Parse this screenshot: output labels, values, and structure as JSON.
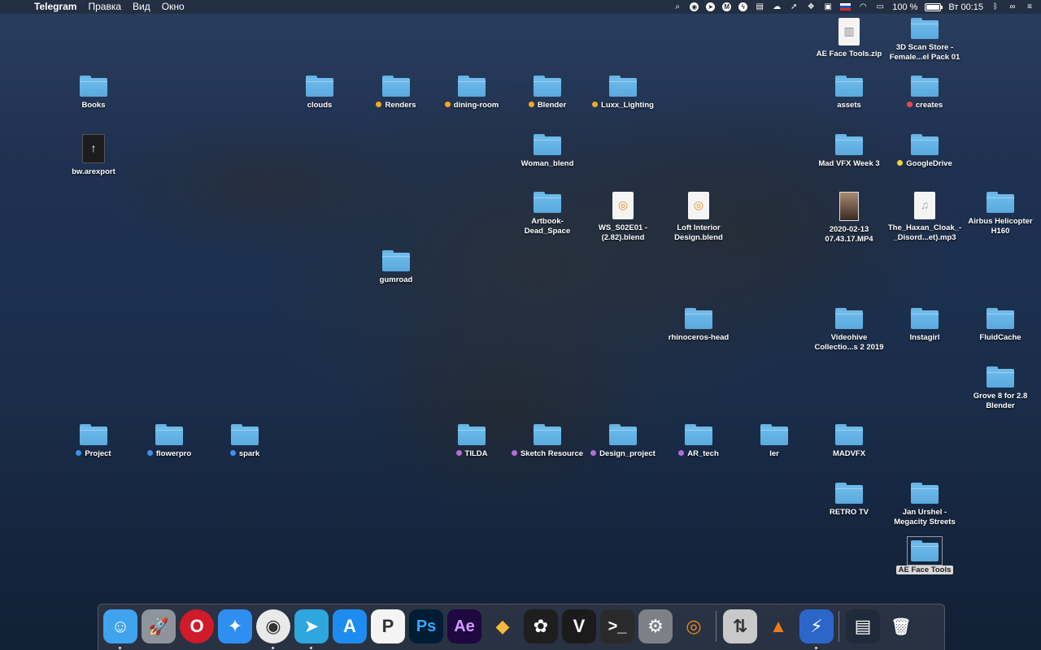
{
  "menubar": {
    "apple_icon": "apple-icon",
    "app_name": "Telegram",
    "menus": [
      "Правка",
      "Вид",
      "Окно"
    ],
    "tray_icons": [
      "search-icon",
      "siri-icon",
      "telegram-tray-icon",
      "mail-tray-icon",
      "flash-icon",
      "notes-icon",
      "cloud-icon",
      "location-icon",
      "dropbox-icon",
      "train-icon",
      "flag-ru-icon",
      "wifi-icon",
      "airplay-icon"
    ],
    "battery": "100 %",
    "battery_level": 1.0,
    "clock": "Вт 00:15",
    "extra_icons": [
      "bluetooth-icon",
      "glasses-icon",
      "menu-list-icon"
    ]
  },
  "desktop": {
    "icons": [
      {
        "type": "doc-zip",
        "label": "AE Face Tools.zip"
      },
      {
        "type": "folder",
        "label": "3D Scan Store - Female...el Pack 01"
      },
      {
        "type": "folder",
        "label": "Books"
      },
      {
        "type": "folder",
        "label": "clouds"
      },
      {
        "type": "folder",
        "label": "Renders",
        "tag": "#f5a623"
      },
      {
        "type": "folder",
        "label": "dining-room",
        "tag": "#f5a623"
      },
      {
        "type": "folder",
        "label": "Blender",
        "tag": "#f5a623"
      },
      {
        "type": "folder",
        "label": "Luxx_Lighting",
        "tag": "#f5a623"
      },
      {
        "type": "folder",
        "label": "assets"
      },
      {
        "type": "folder",
        "label": "creates",
        "tag": "#f0454a"
      },
      {
        "type": "doc-dark",
        "label": "bw.arexport"
      },
      {
        "type": "folder",
        "label": "Woman_blend"
      },
      {
        "type": "folder",
        "label": "Mad VFX Week 3"
      },
      {
        "type": "folder",
        "label": "GoogleDrive",
        "tag": "#f2d13a"
      },
      {
        "type": "folder",
        "label": "Artbook-Dead_Space"
      },
      {
        "type": "doc-blend",
        "label": "WS_S02E01 - (2.82).blend"
      },
      {
        "type": "doc-blend",
        "label": "Loft Interior Design.blend"
      },
      {
        "type": "thumb",
        "label": "2020-02-13 07.43.17.MP4"
      },
      {
        "type": "doc-audio",
        "label": "The_Haxan_Cloak_-_Disord...et).mp3"
      },
      {
        "type": "folder",
        "label": "Airbus Helicopter H160"
      },
      {
        "type": "folder",
        "label": "gumroad"
      },
      {
        "type": "folder",
        "label": "rhinoceros-head"
      },
      {
        "type": "folder",
        "label": "Videohive Collectio...s 2 2019"
      },
      {
        "type": "folder",
        "label": "Instagirl"
      },
      {
        "type": "folder",
        "label": "FluidCache"
      },
      {
        "type": "folder",
        "label": "Grove 8 for 2.8 Blender"
      },
      {
        "type": "folder",
        "label": "Project",
        "tag": "#3b8ff0"
      },
      {
        "type": "folder",
        "label": "flowerpro",
        "tag": "#3b8ff0"
      },
      {
        "type": "folder",
        "label": "spark",
        "tag": "#3b8ff0"
      },
      {
        "type": "folder",
        "label": "TILDA",
        "tag": "#b66bdc"
      },
      {
        "type": "folder",
        "label": "Sketch Resource",
        "tag": "#b66bdc"
      },
      {
        "type": "folder",
        "label": "Design_project",
        "tag": "#b66bdc"
      },
      {
        "type": "folder",
        "label": "AR_tech",
        "tag": "#b66bdc"
      },
      {
        "type": "folder",
        "label": "ler"
      },
      {
        "type": "folder",
        "label": "MADVFX"
      },
      {
        "type": "folder",
        "label": "RETRO TV"
      },
      {
        "type": "folder",
        "label": "Jan Urshel - Megacity Streets"
      },
      {
        "type": "folder",
        "label": "AE Face Tools",
        "selected": true
      }
    ]
  },
  "dock": {
    "apps": [
      {
        "name": "finder-icon",
        "glyph": "☺",
        "bg": "#3fa3ef",
        "running": true
      },
      {
        "name": "launchpad-icon",
        "glyph": "🚀",
        "bg": "#8e949c"
      },
      {
        "name": "opera-icon",
        "glyph": "O",
        "bg": "#d11a2a"
      },
      {
        "name": "safari-icon",
        "glyph": "✦",
        "bg": "#2e8ff0"
      },
      {
        "name": "chrome-icon",
        "glyph": "◉",
        "bg": "#e9e9e9",
        "running": true
      },
      {
        "name": "telegram-icon",
        "glyph": "➤",
        "bg": "#2ea6de",
        "running": true
      },
      {
        "name": "app-store-icon",
        "glyph": "A",
        "bg": "#1d8cf0"
      },
      {
        "name": "patreon-like-icon",
        "glyph": "P",
        "bg": "#f4f4f4"
      },
      {
        "name": "photoshop-icon",
        "glyph": "Ps",
        "bg": "#001d34"
      },
      {
        "name": "after-effects-icon",
        "glyph": "Ae",
        "bg": "#1f0740"
      },
      {
        "name": "sketch-icon",
        "glyph": "◆",
        "bg": "transparent"
      },
      {
        "name": "figma-icon",
        "glyph": "✿",
        "bg": "#1e1e1e"
      },
      {
        "name": "vectorize-icon",
        "glyph": "V",
        "bg": "#1b1b1b"
      },
      {
        "name": "terminal-icon",
        "glyph": ">_",
        "bg": "#2a2a2a"
      },
      {
        "name": "system-preferences-icon",
        "glyph": "⚙",
        "bg": "#7d8086"
      },
      {
        "name": "blender-icon",
        "glyph": "◎",
        "bg": "transparent"
      },
      {
        "name": "transmit-icon",
        "glyph": "⇅",
        "bg": "#c9c9c9"
      },
      {
        "name": "vlc-icon",
        "glyph": "▲",
        "bg": "transparent"
      },
      {
        "name": "thunder-icon",
        "glyph": "⚡",
        "bg": "#2b67c9",
        "running": true
      },
      {
        "name": "telegram-window-thumb-icon",
        "glyph": "▤",
        "bg": "#1f2a3a"
      },
      {
        "name": "trash-icon",
        "glyph": "🗑",
        "bg": "transparent"
      }
    ]
  }
}
